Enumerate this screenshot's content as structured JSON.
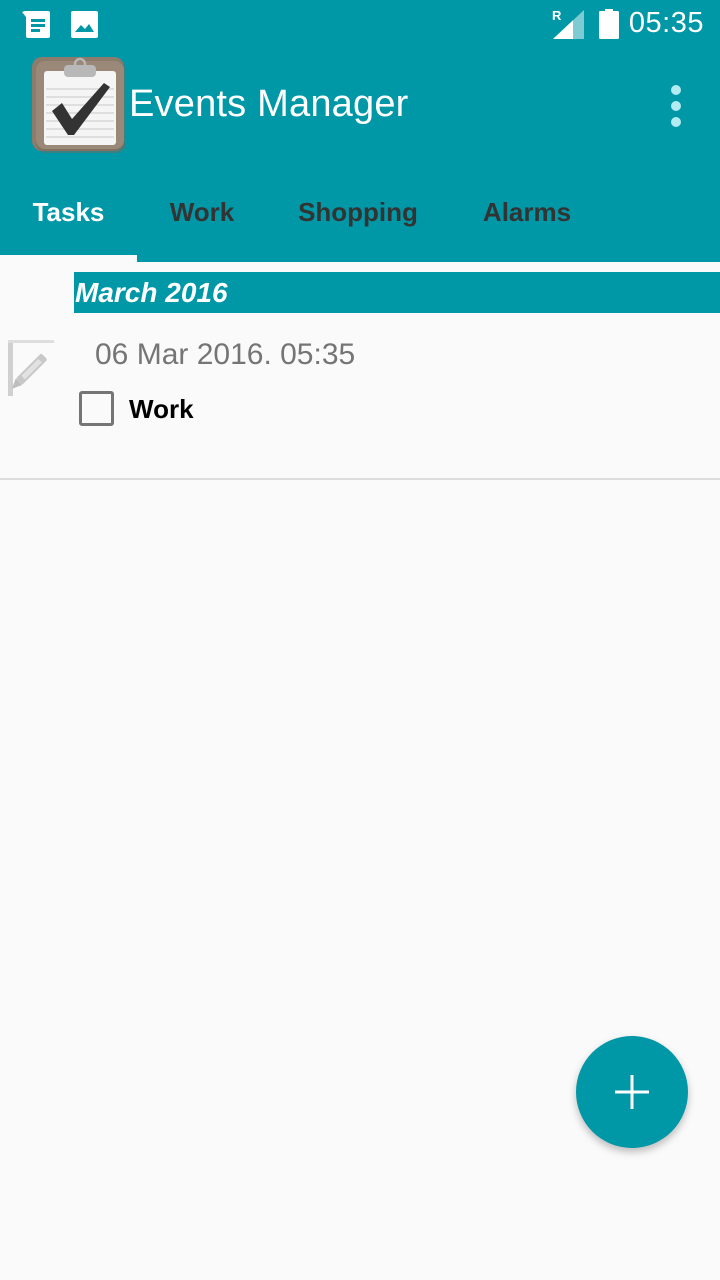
{
  "status_bar": {
    "time": "05:35",
    "roaming_indicator": "R",
    "left_icons": [
      "message-notification-icon",
      "image-notification-icon"
    ],
    "right_icons": [
      "signal-icon",
      "battery-icon"
    ]
  },
  "app_bar": {
    "title": "Events Manager",
    "logo": "clipboard-checkmark-logo",
    "overflow_icon": "more-vert-icon"
  },
  "tabs": [
    {
      "label": "Tasks",
      "active": true
    },
    {
      "label": "Work",
      "active": false
    },
    {
      "label": "Shopping",
      "active": false
    },
    {
      "label": "Alarms",
      "active": false
    }
  ],
  "sections": [
    {
      "title": "March 2016",
      "items": [
        {
          "date": "06 Mar 2016. 05:35",
          "name": "Work",
          "checked": false,
          "icon": "edit-icon"
        }
      ]
    }
  ],
  "fab": {
    "icon": "plus-icon",
    "action": "add"
  },
  "colors": {
    "primary": "#0097a7",
    "overflow_dots": "#b2ebf2",
    "inactive_tab_text": "#333333",
    "secondary_text": "#757575",
    "background": "#fafafa"
  }
}
